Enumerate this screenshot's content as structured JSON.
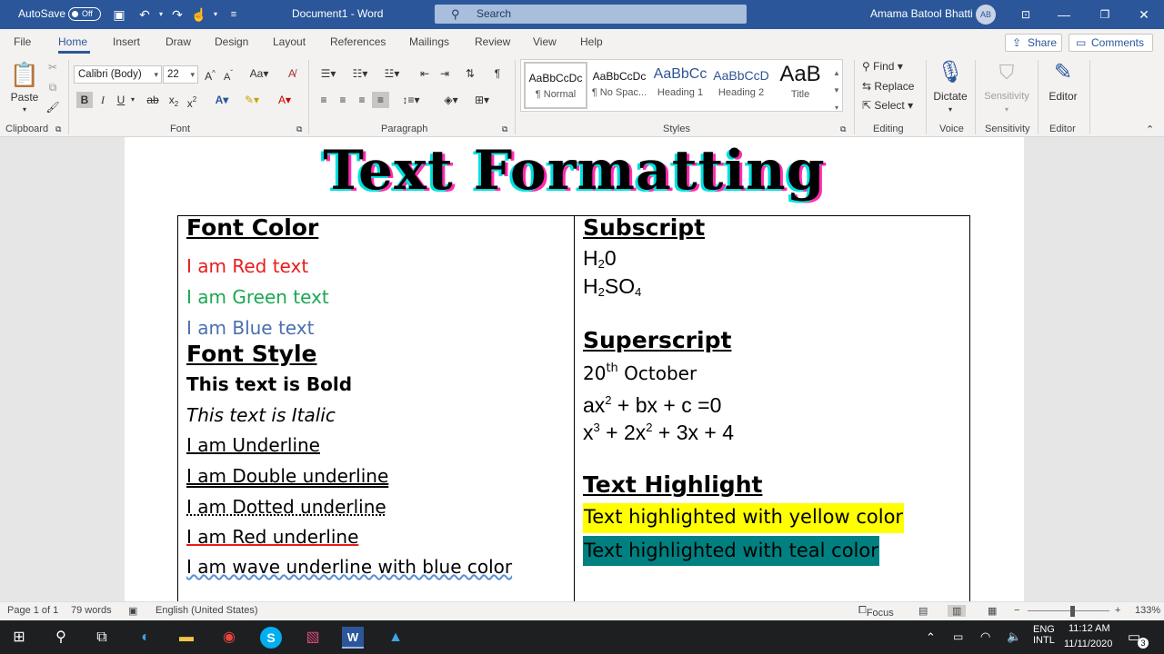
{
  "titlebar": {
    "autosave_label": "AutoSave",
    "autosave_state": "Off",
    "document_name": "Document1  -  Word",
    "search_placeholder": "Search",
    "user_name": "Amama Batool Bhatti",
    "user_initials": "AB"
  },
  "tabs": [
    "File",
    "Home",
    "Insert",
    "Draw",
    "Design",
    "Layout",
    "References",
    "Mailings",
    "Review",
    "View",
    "Help"
  ],
  "share_label": "Share",
  "comments_label": "Comments",
  "ribbon": {
    "paste_label": "Paste",
    "font_name": "Calibri (Body)",
    "font_size": "22",
    "styles": [
      {
        "preview": "AaBbCcDc",
        "name": "¶ Normal"
      },
      {
        "preview": "AaBbCcDc",
        "name": "¶ No Spac..."
      },
      {
        "preview": "AaBbCc",
        "name": "Heading 1"
      },
      {
        "preview": "AaBbCcD",
        "name": "Heading 2"
      },
      {
        "preview": "AaB",
        "name": "Title"
      }
    ],
    "find_label": "Find",
    "replace_label": "Replace",
    "select_label": "Select",
    "dictate_label": "Dictate",
    "sensitivity_label": "Sensitivity",
    "editor_label": "Editor",
    "groups": [
      "Clipboard",
      "Font",
      "Paragraph",
      "Styles",
      "Editing",
      "Voice",
      "Sensitivity",
      "Editor"
    ]
  },
  "document": {
    "title": "Text Formatting",
    "left": {
      "heading1": "Font Color",
      "red_text": "I am Red text",
      "green_text": "I am Green text",
      "blue_text": "I am Blue text",
      "heading2": "Font Style",
      "bold_text": "This text is Bold",
      "italic_text": "This text is Italic",
      "underline_text": "I am Underline",
      "double_underline_text": "I am Double underline",
      "dotted_underline_text": "I am Dotted underline",
      "red_underline_text": "I am Red underline",
      "wave_underline_text": "I am wave underline with blue color"
    },
    "right": {
      "heading1": "Subscript",
      "heading2": "Superscript",
      "date_main": "20",
      "date_sup": "th",
      "date_rest": " October",
      "heading3": "Text Highlight",
      "yellow_text": "Text highlighted with yellow color",
      "teal_text": "Text highlighted with teal color"
    }
  },
  "status": {
    "page": "Page 1 of 1",
    "words": "79 words",
    "language": "English (United States)",
    "focus": "Focus",
    "zoom": "133%"
  },
  "taskbar": {
    "lang1": "ENG",
    "lang2": "INTL",
    "time": "11:12 AM",
    "date": "11/11/2020",
    "notifications": "3"
  },
  "colors": {
    "accent": "#2b579a",
    "red": "#e81c1c",
    "green": "#1aa851",
    "blue": "#4a6fb0",
    "yellow_highlight": "#ffff00",
    "teal_highlight": "#008080"
  }
}
